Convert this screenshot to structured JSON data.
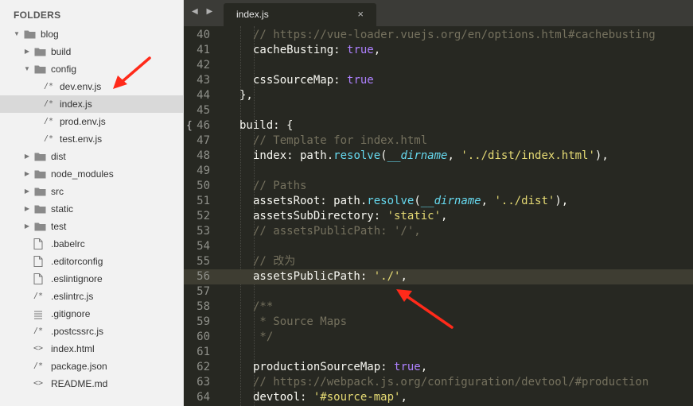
{
  "sidebar": {
    "title": "FOLDERS",
    "tree": [
      {
        "label": "blog",
        "type": "folder",
        "depth": 0,
        "expanded": true
      },
      {
        "label": "build",
        "type": "folder",
        "depth": 1,
        "expanded": false
      },
      {
        "label": "config",
        "type": "folder",
        "depth": 1,
        "expanded": true
      },
      {
        "label": "dev.env.js",
        "type": "file",
        "glyph": "/*",
        "depth": 2
      },
      {
        "label": "index.js",
        "type": "file",
        "glyph": "/*",
        "depth": 2,
        "selected": true
      },
      {
        "label": "prod.env.js",
        "type": "file",
        "glyph": "/*",
        "depth": 2
      },
      {
        "label": "test.env.js",
        "type": "file",
        "glyph": "/*",
        "depth": 2
      },
      {
        "label": "dist",
        "type": "folder",
        "depth": 1,
        "expanded": false
      },
      {
        "label": "node_modules",
        "type": "folder",
        "depth": 1,
        "expanded": false
      },
      {
        "label": "src",
        "type": "folder",
        "depth": 1,
        "expanded": false
      },
      {
        "label": "static",
        "type": "folder",
        "depth": 1,
        "expanded": false
      },
      {
        "label": "test",
        "type": "folder",
        "depth": 1,
        "expanded": false
      },
      {
        "label": ".babelrc",
        "type": "file",
        "glyph": "doc",
        "depth": 1
      },
      {
        "label": ".editorconfig",
        "type": "file",
        "glyph": "doc",
        "depth": 1
      },
      {
        "label": ".eslintignore",
        "type": "file",
        "glyph": "doc",
        "depth": 1
      },
      {
        "label": ".eslintrc.js",
        "type": "file",
        "glyph": "/*",
        "depth": 1
      },
      {
        "label": ".gitignore",
        "type": "file",
        "glyph": "lines",
        "depth": 1
      },
      {
        "label": ".postcssrc.js",
        "type": "file",
        "glyph": "/*",
        "depth": 1
      },
      {
        "label": "index.html",
        "type": "file",
        "glyph": "<>",
        "depth": 1
      },
      {
        "label": "package.json",
        "type": "file",
        "glyph": "/*",
        "depth": 1
      },
      {
        "label": "README.md",
        "type": "file",
        "glyph": "<>",
        "depth": 1
      }
    ]
  },
  "tabbar": {
    "nav": "◀ ▶",
    "tab_label": "index.js",
    "close": "×"
  },
  "editor": {
    "current_line": 56,
    "fold_marker_line": 46,
    "fold_marker": "{",
    "lines": [
      {
        "n": 40,
        "indent": 2,
        "tokens": [
          [
            "com",
            "// https://vue-loader.vuejs.org/en/options.html#cachebusting"
          ]
        ]
      },
      {
        "n": 41,
        "indent": 2,
        "tokens": [
          [
            "key",
            "cacheBusting: "
          ],
          [
            "bool",
            "true"
          ],
          [
            "key",
            ","
          ]
        ]
      },
      {
        "n": 42,
        "indent": 0,
        "tokens": []
      },
      {
        "n": 43,
        "indent": 2,
        "tokens": [
          [
            "key",
            "cssSourceMap: "
          ],
          [
            "bool",
            "true"
          ]
        ]
      },
      {
        "n": 44,
        "indent": 1,
        "tokens": [
          [
            "key",
            "},"
          ]
        ]
      },
      {
        "n": 45,
        "indent": 0,
        "tokens": []
      },
      {
        "n": 46,
        "indent": 1,
        "tokens": [
          [
            "key",
            "build: {"
          ]
        ]
      },
      {
        "n": 47,
        "indent": 2,
        "tokens": [
          [
            "com",
            "// Template for index.html"
          ]
        ]
      },
      {
        "n": 48,
        "indent": 2,
        "tokens": [
          [
            "key",
            "index: path."
          ],
          [
            "fn",
            "resolve"
          ],
          [
            "key",
            "("
          ],
          [
            "var",
            "__dirname"
          ],
          [
            "key",
            ", "
          ],
          [
            "str",
            "'../dist/index.html'"
          ],
          [
            "key",
            "),"
          ]
        ]
      },
      {
        "n": 49,
        "indent": 0,
        "tokens": []
      },
      {
        "n": 50,
        "indent": 2,
        "tokens": [
          [
            "com",
            "// Paths"
          ]
        ]
      },
      {
        "n": 51,
        "indent": 2,
        "tokens": [
          [
            "key",
            "assetsRoot: path."
          ],
          [
            "fn",
            "resolve"
          ],
          [
            "key",
            "("
          ],
          [
            "var",
            "__dirname"
          ],
          [
            "key",
            ", "
          ],
          [
            "str",
            "'../dist'"
          ],
          [
            "key",
            "),"
          ]
        ]
      },
      {
        "n": 52,
        "indent": 2,
        "tokens": [
          [
            "key",
            "assetsSubDirectory: "
          ],
          [
            "str",
            "'static'"
          ],
          [
            "key",
            ","
          ]
        ]
      },
      {
        "n": 53,
        "indent": 2,
        "tokens": [
          [
            "com",
            "// assetsPublicPath: '/',"
          ]
        ]
      },
      {
        "n": 54,
        "indent": 0,
        "tokens": []
      },
      {
        "n": 55,
        "indent": 2,
        "tokens": [
          [
            "com",
            "// 改为"
          ]
        ]
      },
      {
        "n": 56,
        "indent": 2,
        "tokens": [
          [
            "key",
            "assetsPublicPath: "
          ],
          [
            "str",
            "'./'"
          ],
          [
            "key",
            ","
          ]
        ]
      },
      {
        "n": 57,
        "indent": 0,
        "tokens": []
      },
      {
        "n": 58,
        "indent": 2,
        "tokens": [
          [
            "com",
            "/**"
          ]
        ]
      },
      {
        "n": 59,
        "indent": 2,
        "tokens": [
          [
            "com",
            " * Source Maps"
          ]
        ]
      },
      {
        "n": 60,
        "indent": 2,
        "tokens": [
          [
            "com",
            " */"
          ]
        ]
      },
      {
        "n": 61,
        "indent": 0,
        "tokens": []
      },
      {
        "n": 62,
        "indent": 2,
        "tokens": [
          [
            "key",
            "productionSourceMap: "
          ],
          [
            "bool",
            "true"
          ],
          [
            "key",
            ","
          ]
        ]
      },
      {
        "n": 63,
        "indent": 2,
        "tokens": [
          [
            "com",
            "// https://webpack.js.org/configuration/devtool/#production"
          ]
        ]
      },
      {
        "n": 64,
        "indent": 2,
        "tokens": [
          [
            "key",
            "devtool: "
          ],
          [
            "str",
            "'#source-map'"
          ],
          [
            "key",
            ","
          ]
        ]
      }
    ]
  },
  "colors": {
    "editor_bg": "#272822",
    "comment": "#75715e",
    "string": "#e6db74",
    "boolean": "#ae81ff",
    "function": "#66d9ef",
    "annotation_arrow": "#ff2a1a"
  }
}
